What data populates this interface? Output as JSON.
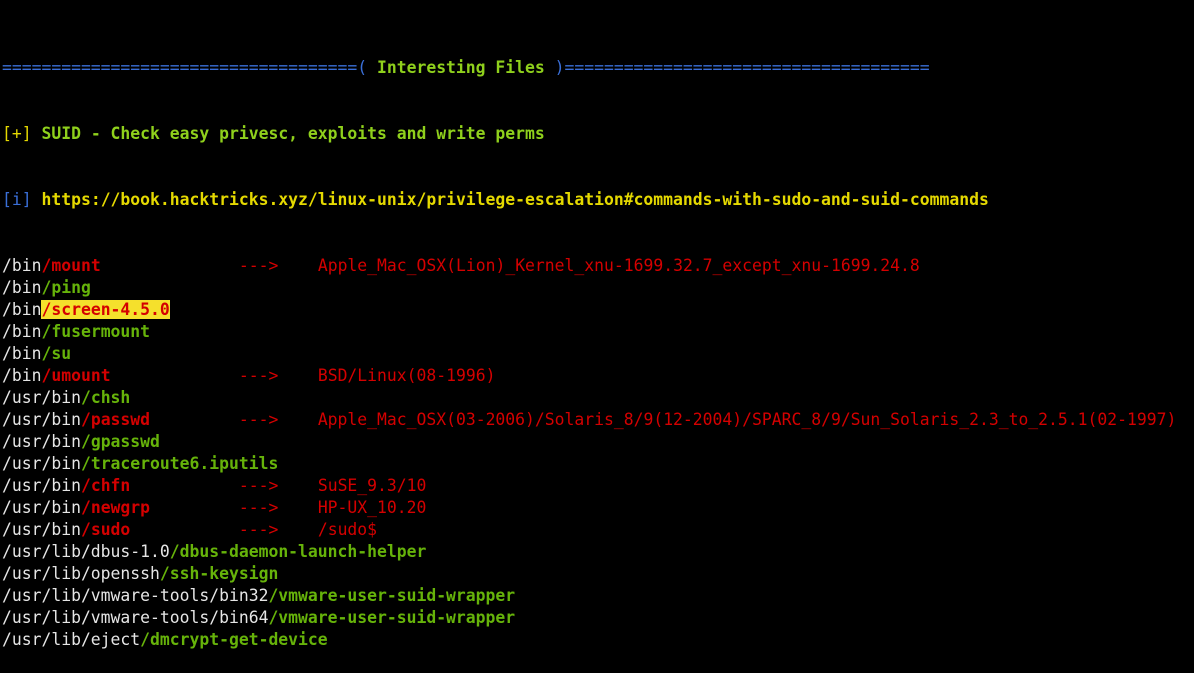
{
  "banner": {
    "left": "====================================( ",
    "title": "Interesting Files",
    "right": " )====================================="
  },
  "section": {
    "tag": "[+]",
    "heading": "SUID - Check easy privesc, exploits and write perms",
    "info_tag": "[i]",
    "link": "https://book.hacktricks.xyz/linux-unix/privilege-escalation#commands-with-sudo-and-suid-commands"
  },
  "arrow": "--->",
  "entries": [
    {
      "dir": "/bin",
      "bin": "/mount",
      "style": "red",
      "exploit": "Apple_Mac_OSX(Lion)_Kernel_xnu-1699.32.7_except_xnu-1699.24.8"
    },
    {
      "dir": "/bin",
      "bin": "/ping",
      "style": "green",
      "exploit": ""
    },
    {
      "dir": "/bin",
      "bin": "/screen-4.5.0",
      "style": "highlight",
      "exploit": ""
    },
    {
      "dir": "/bin",
      "bin": "/fusermount",
      "style": "green",
      "exploit": ""
    },
    {
      "dir": "/bin",
      "bin": "/su",
      "style": "green",
      "exploit": ""
    },
    {
      "dir": "/bin",
      "bin": "/umount",
      "style": "red",
      "exploit": "BSD/Linux(08-1996)"
    },
    {
      "dir": "/usr/bin",
      "bin": "/chsh",
      "style": "green",
      "exploit": ""
    },
    {
      "dir": "/usr/bin",
      "bin": "/passwd",
      "style": "red",
      "exploit": "Apple_Mac_OSX(03-2006)/Solaris_8/9(12-2004)/SPARC_8/9/Sun_Solaris_2.3_to_2.5.1(02-1997)"
    },
    {
      "dir": "/usr/bin",
      "bin": "/gpasswd",
      "style": "green",
      "exploit": ""
    },
    {
      "dir": "/usr/bin",
      "bin": "/traceroute6.iputils",
      "style": "green",
      "exploit": ""
    },
    {
      "dir": "/usr/bin",
      "bin": "/chfn",
      "style": "red",
      "exploit": "SuSE_9.3/10"
    },
    {
      "dir": "/usr/bin",
      "bin": "/newgrp",
      "style": "red",
      "exploit": "HP-UX_10.20"
    },
    {
      "dir": "/usr/bin",
      "bin": "/sudo",
      "style": "red",
      "exploit": "/sudo$"
    },
    {
      "dir": "/usr/lib/dbus-1.0",
      "bin": "/dbus-daemon-launch-helper",
      "style": "green",
      "exploit": ""
    },
    {
      "dir": "/usr/lib/openssh",
      "bin": "/ssh-keysign",
      "style": "green",
      "exploit": ""
    },
    {
      "dir": "/usr/lib/vmware-tools/bin32",
      "bin": "/vmware-user-suid-wrapper",
      "style": "green",
      "exploit": ""
    },
    {
      "dir": "/usr/lib/vmware-tools/bin64",
      "bin": "/vmware-user-suid-wrapper",
      "style": "green",
      "exploit": ""
    },
    {
      "dir": "/usr/lib/eject",
      "bin": "/dmcrypt-get-device",
      "style": "green",
      "exploit": ""
    }
  ],
  "colors": {
    "background": "#000000",
    "banner": "#3a6fd8",
    "heading": "#8fd01c",
    "vulnerable": "#d40000",
    "safe": "#66b30a",
    "highlight_bg": "#f5e02c"
  }
}
